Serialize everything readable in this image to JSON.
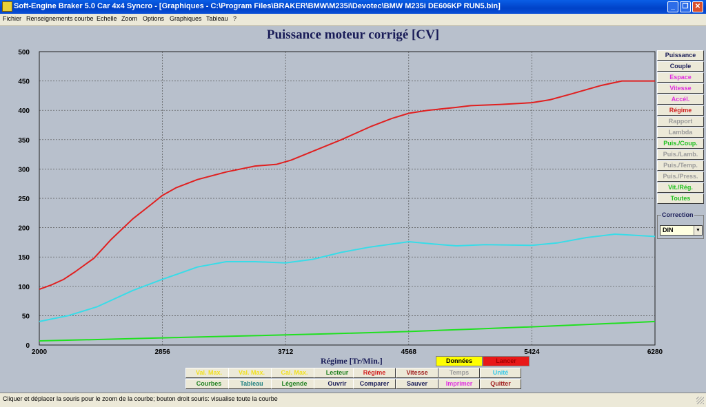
{
  "window": {
    "title": "Soft-Engine Braker 5.0 Car 4x4 Syncro - [Graphiques - C:\\Program Files\\BRAKER\\BMW\\M235i\\Devotec\\BMW M235i DE606KP RUN5.bin]",
    "buttons": {
      "minimize": "_",
      "maximize": "❐",
      "close": "✕"
    }
  },
  "menu": [
    "Fichier",
    "Renseignements courbe",
    "Echelle",
    "Zoom",
    "Options",
    "Graphiques",
    "Tableau",
    "?"
  ],
  "chart_data": {
    "type": "line",
    "title": "Puissance moteur corrigé [CV]",
    "xlabel": "Régime [Tr/Min.]",
    "ylabel": "",
    "xlim": [
      2000,
      6280
    ],
    "ylim": [
      0,
      500
    ],
    "xticks": [
      2000,
      2856,
      3712,
      4568,
      5424,
      6280
    ],
    "yticks": [
      0,
      50,
      100,
      150,
      200,
      250,
      300,
      350,
      400,
      450,
      500
    ],
    "grid": true,
    "series": [
      {
        "color": "#e02020",
        "x": [
          2000,
          2080,
          2170,
          2250,
          2380,
          2500,
          2650,
          2780,
          2856,
          2950,
          3100,
          3300,
          3500,
          3650,
          3750,
          3900,
          4100,
          4300,
          4450,
          4568,
          4700,
          4900,
          5000,
          5200,
          5424,
          5550,
          5700,
          5900,
          6050,
          6280
        ],
        "y": [
          95,
          102,
          112,
          125,
          148,
          180,
          215,
          240,
          255,
          268,
          282,
          295,
          305,
          308,
          315,
          330,
          350,
          372,
          386,
          395,
          400,
          405,
          408,
          410,
          413,
          418,
          428,
          442,
          450,
          450
        ]
      },
      {
        "color": "#38dce8",
        "x": [
          2000,
          2200,
          2400,
          2650,
          2856,
          3100,
          3300,
          3500,
          3712,
          3900,
          4100,
          4300,
          4568,
          4750,
          4900,
          5100,
          5424,
          5600,
          5800,
          6000,
          6280
        ],
        "y": [
          40,
          50,
          65,
          93,
          112,
          133,
          142,
          142,
          140,
          146,
          158,
          167,
          176,
          172,
          169,
          171,
          170,
          174,
          183,
          189,
          185
        ]
      },
      {
        "color": "#20e020",
        "x": [
          2000,
          2500,
          3000,
          3500,
          4000,
          4568,
          5000,
          5424,
          5800,
          6100,
          6280
        ],
        "y": [
          7,
          10,
          13,
          16,
          19,
          23,
          27,
          31,
          35,
          38,
          40
        ]
      }
    ]
  },
  "right_panel": {
    "buttons": [
      {
        "label": "Puissance",
        "color": "#1a1d58"
      },
      {
        "label": "Couple",
        "color": "#1a1d58"
      },
      {
        "label": "Espace",
        "color": "#e030e0"
      },
      {
        "label": "Vitesse",
        "color": "#e030e0"
      },
      {
        "label": "Accél.",
        "color": "#e030e0"
      },
      {
        "label": "Régime",
        "color": "#d02020"
      },
      {
        "label": "Rapport",
        "color": "#9a9a9a"
      },
      {
        "label": "Lambda",
        "color": "#9a9a9a"
      },
      {
        "label": "Puis./Coup.",
        "color": "#20c020"
      },
      {
        "label": "Puis./Lamb.",
        "color": "#9a9a9a"
      },
      {
        "label": "Puis./Temp.",
        "color": "#9a9a9a"
      },
      {
        "label": "Puis./Press.",
        "color": "#9a9a9a"
      },
      {
        "label": "Vit./Rég.",
        "color": "#20c020"
      },
      {
        "label": "Toutes",
        "color": "#20c020"
      }
    ],
    "correction": {
      "label": "Correction",
      "value": "DIN"
    }
  },
  "bottom_panel": {
    "donnees": "Données",
    "lancer": "Lancer",
    "row1": [
      {
        "label": "Val. Max.",
        "color": "#f0e020"
      },
      {
        "label": "Val. Max.",
        "color": "#f0e020"
      },
      {
        "label": "Cal. Max.",
        "color": "#f0e020"
      },
      {
        "label": "Lecteur",
        "color": "#208020"
      },
      {
        "label": "Régime",
        "color": "#d02020"
      },
      {
        "label": "Vitesse",
        "color": "#a02020"
      },
      {
        "label": "Temps",
        "color": "#9a9a9a"
      },
      {
        "label": "Unité",
        "color": "#38c8e8"
      }
    ],
    "row2": [
      {
        "label": "Courbes",
        "color": "#208020"
      },
      {
        "label": "Tableau",
        "color": "#208080"
      },
      {
        "label": "Légende",
        "color": "#208020"
      },
      {
        "label": "Ouvrir",
        "color": "#1a1d58"
      },
      {
        "label": "Comparer",
        "color": "#1a1d58"
      },
      {
        "label": "Sauver",
        "color": "#1a1d58"
      },
      {
        "label": "Imprimer",
        "color": "#e030e0"
      },
      {
        "label": "Quitter",
        "color": "#a02020"
      }
    ]
  },
  "status": "Cliquer et déplacer la souris pour le zoom de la courbe; bouton droit souris: visualise toute la courbe"
}
